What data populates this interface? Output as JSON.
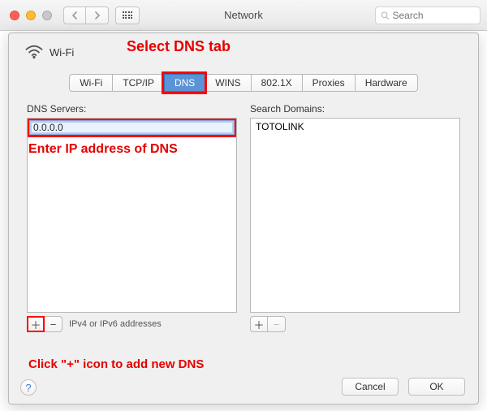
{
  "titlebar": {
    "title": "Network",
    "search_placeholder": "Search"
  },
  "sheet": {
    "wifi_label": "Wi-Fi",
    "tabs": {
      "wifi": "Wi-Fi",
      "tcpip": "TCP/IP",
      "dns": "DNS",
      "wins": "WINS",
      "8021x": "802.1X",
      "proxies": "Proxies",
      "hardware": "Hardware"
    },
    "dns": {
      "label": "DNS Servers:",
      "input_value": "0.0.0.0",
      "footer_hint": "IPv4 or IPv6 addresses"
    },
    "domains": {
      "label": "Search Domains:",
      "items": [
        "TOTOLINK"
      ]
    },
    "buttons": {
      "cancel": "Cancel",
      "ok": "OK",
      "help": "?"
    }
  },
  "annotations": {
    "a1": "Select DNS tab",
    "a2": "Enter IP address of DNS",
    "a3": "Click \"+\" icon to add new DNS"
  },
  "icons": {
    "plus": "＋",
    "minus": "−"
  }
}
